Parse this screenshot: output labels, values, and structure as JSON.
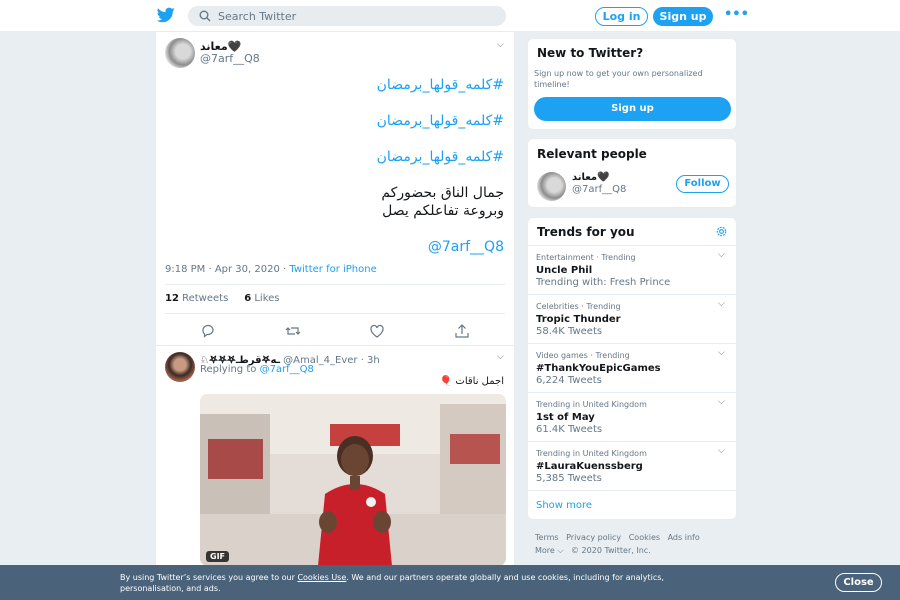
{
  "header": {
    "logo_icon": "twitter-bird-icon",
    "search_placeholder": "Search Twitter",
    "login_label": "Log in",
    "signup_label": "Sign up",
    "more_label": "•••"
  },
  "tweet": {
    "author_name": "معاند🖤",
    "author_handle": "@7arf__Q8",
    "lines": [
      "#كلمه_قولها_برمضان",
      "#كلمه_قولها_برمضان",
      "#كلمه_قولها_برمضان",
      "جمال الناق بحضوركم",
      "وبروعة تفاعلكم يصل",
      "@7arf__Q8"
    ],
    "timestamp": "9:18 PM · Apr 30, 2020 · ",
    "source": "Twitter for iPhone",
    "retweets_count": "12",
    "retweets_label": "Retweets",
    "likes_count": "6",
    "likes_label": "Likes"
  },
  "reply": {
    "author_name": "♘𖤐𖤐𖤐قرطـ𖤐ـه",
    "author_handle": "@Amal_4_Ever · 3h",
    "replying_prefix": "Replying to ",
    "replying_to": "@7arf__Q8",
    "text": "اجمل ناقات 🎈",
    "gif_label": "GIF"
  },
  "new_to_twitter": {
    "title": "New to Twitter?",
    "description": "Sign up now to get your own personalized timeline!",
    "button": "Sign up"
  },
  "relevant": {
    "title": "Relevant people",
    "name": "معاند🖤",
    "handle": "@7arf__Q8",
    "follow": "Follow"
  },
  "trends": {
    "title": "Trends for you",
    "items": [
      {
        "category": "Entertainment · Trending",
        "name": "Uncle Phil",
        "sub": "Trending with: Fresh Prince"
      },
      {
        "category": "Celebrities · Trending",
        "name": "Tropic Thunder",
        "sub": "58.4K Tweets"
      },
      {
        "category": "Video games · Trending",
        "name": "#ThankYouEpicGames",
        "sub": "6,224 Tweets"
      },
      {
        "category": "Trending in United Kingdom",
        "name": "1st of May",
        "sub": "61.4K Tweets"
      },
      {
        "category": "Trending in United Kingdom",
        "name": "#LauraKuenssberg",
        "sub": "5,385 Tweets"
      }
    ],
    "show_more": "Show more"
  },
  "footer": {
    "links": [
      "Terms",
      "Privacy policy",
      "Cookies",
      "Ads info"
    ],
    "more": "More ⌵",
    "copyright": "© 2020 Twitter, Inc."
  },
  "cookie": {
    "text_before": "By using Twitter’s services you agree to our ",
    "link": "Cookies Use",
    "text_after": ". We and our partners operate globally and use cookies, including for analytics, personalisation, and ads.",
    "close": "Close"
  },
  "colors": {
    "accent": "#1da1f2",
    "background": "#e6ecf0",
    "cookie_bar": "#4a637a"
  }
}
